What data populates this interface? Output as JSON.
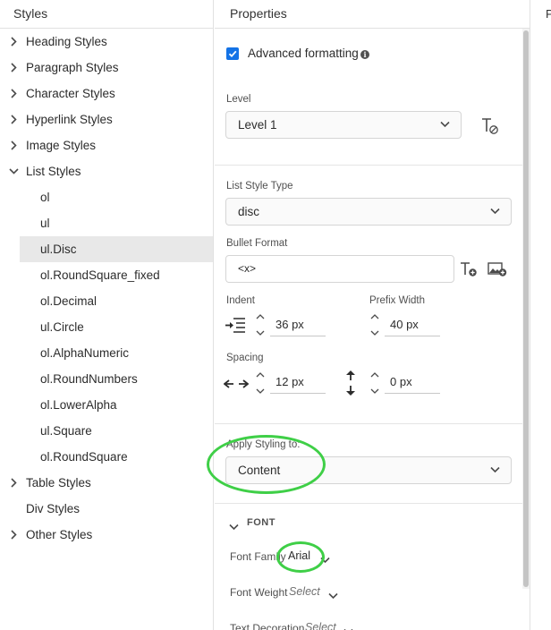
{
  "left_panel": {
    "title": "Styles",
    "items": [
      {
        "label": "Heading Styles"
      },
      {
        "label": "Paragraph Styles"
      },
      {
        "label": "Character Styles"
      },
      {
        "label": "Hyperlink Styles"
      },
      {
        "label": "Image Styles"
      },
      {
        "label": "List Styles"
      },
      {
        "label": "ol"
      },
      {
        "label": "ul"
      },
      {
        "label": "ul.Disc"
      },
      {
        "label": "ol.RoundSquare_fixed"
      },
      {
        "label": "ol.Decimal"
      },
      {
        "label": "ul.Circle"
      },
      {
        "label": "ol.AlphaNumeric"
      },
      {
        "label": "ol.RoundNumbers"
      },
      {
        "label": "ol.LowerAlpha"
      },
      {
        "label": "ul.Square"
      },
      {
        "label": "ol.RoundSquare"
      },
      {
        "label": "Table Styles"
      },
      {
        "label": "Div Styles"
      },
      {
        "label": "Other Styles"
      }
    ],
    "selected": "ul.Disc"
  },
  "properties": {
    "title": "Properties",
    "advanced_formatting_label": "Advanced formatting",
    "advanced_formatting_checked": true,
    "level": {
      "label": "Level",
      "value": "Level 1"
    },
    "list_style_type": {
      "label": "List Style Type",
      "value": "disc"
    },
    "bullet_format": {
      "label": "Bullet Format",
      "value": "<x>"
    },
    "indent": {
      "label": "Indent",
      "value": "36 px"
    },
    "prefix_width": {
      "label": "Prefix Width",
      "value": "40 px"
    },
    "spacing": {
      "label": "Spacing",
      "horizontal_value": "12 px",
      "vertical_value": "0 px"
    },
    "apply_styling": {
      "label": "Apply Styling to:",
      "value": "Content"
    },
    "font": {
      "section_title": "FONT",
      "family_label": "Font Family",
      "family_value": "Arial",
      "weight_label": "Font Weight",
      "weight_value": "Select",
      "decoration_label": "Text Decoration",
      "decoration_value": "Select"
    }
  },
  "far_edge": {
    "letter": "P"
  },
  "colors": {
    "accent": "#1473e6",
    "highlight_oval": "#3fcf47",
    "selected_row": "#e8e8e8"
  }
}
